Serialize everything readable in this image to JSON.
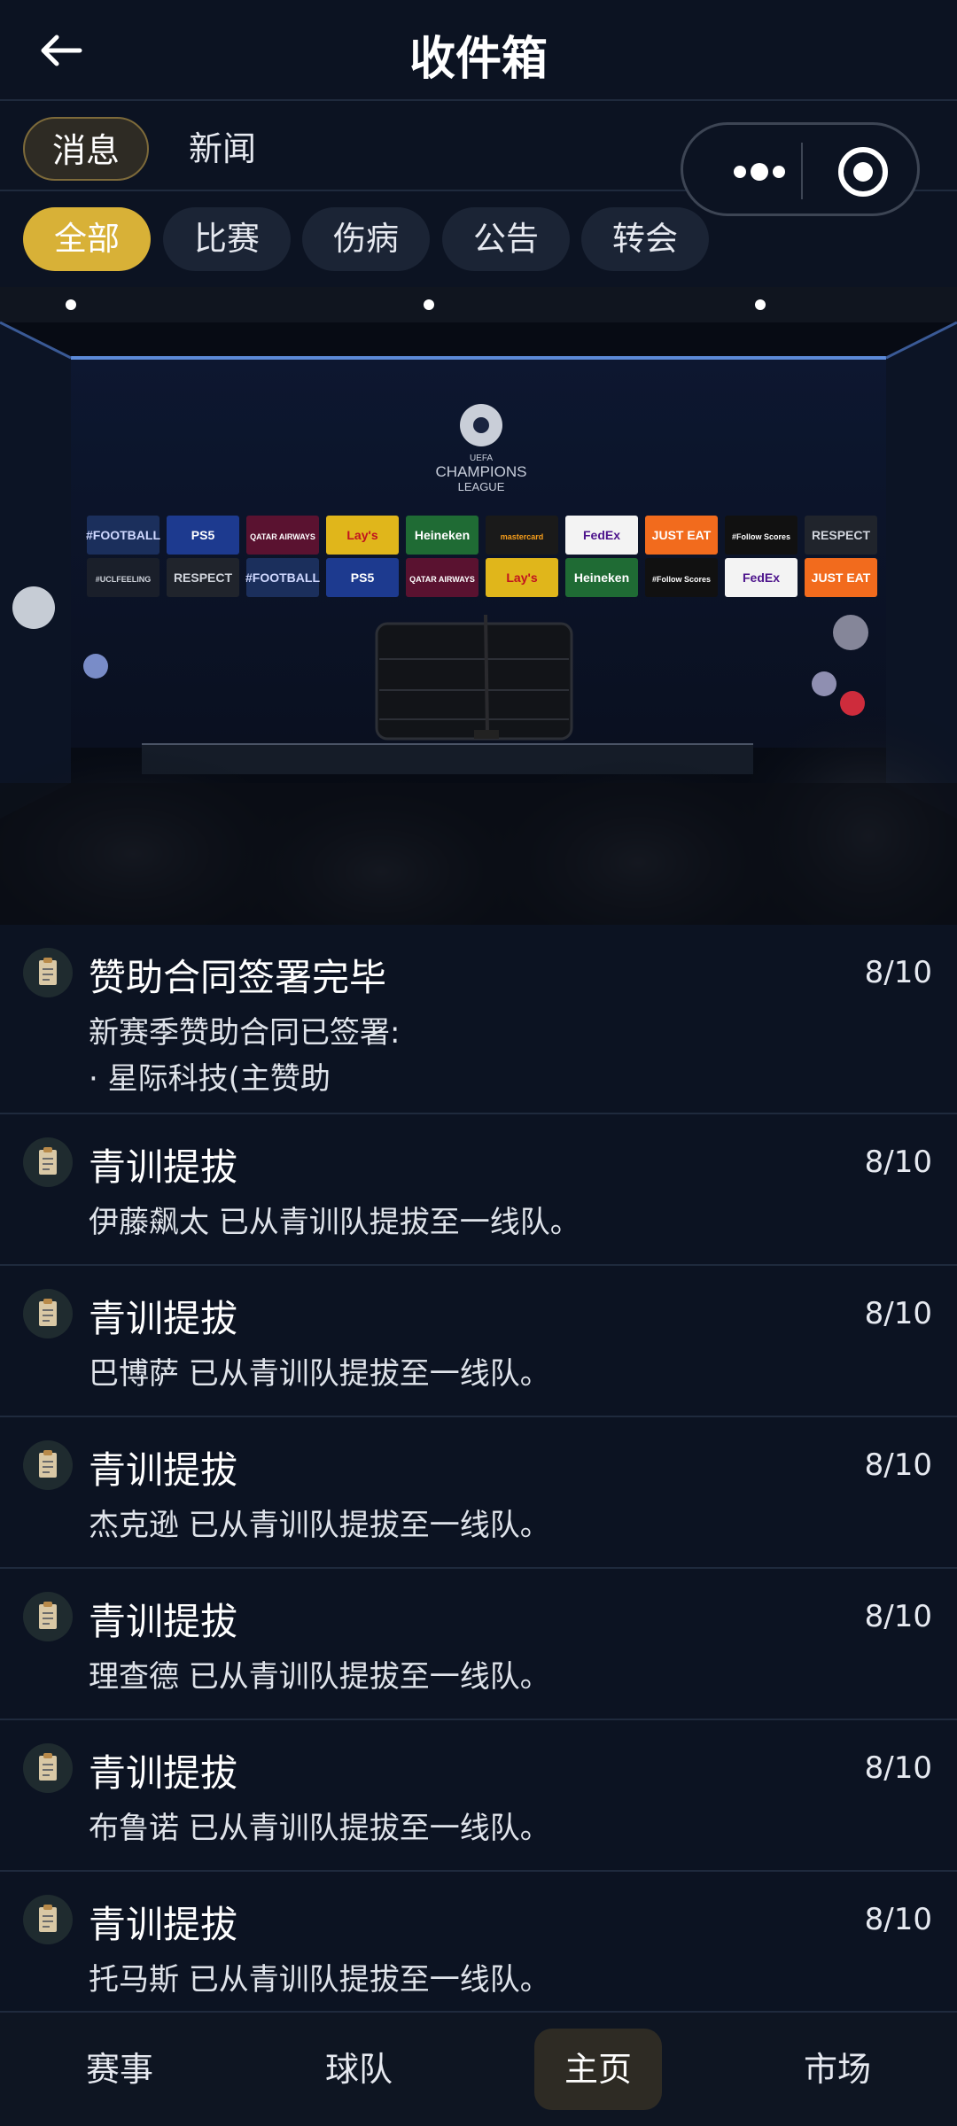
{
  "header": {
    "title": "收件箱",
    "back_icon": "arrow-left-icon"
  },
  "main_tabs": [
    {
      "label": "消息",
      "active": true
    },
    {
      "label": "新闻",
      "active": false
    }
  ],
  "capsule": {
    "more_icon": "more-dots-icon",
    "close_icon": "record-circle-icon"
  },
  "filters": [
    {
      "label": "全部",
      "active": true
    },
    {
      "label": "比赛",
      "active": false
    },
    {
      "label": "伤病",
      "active": false
    },
    {
      "label": "公告",
      "active": false
    },
    {
      "label": "转会",
      "active": false
    }
  ],
  "banner": {
    "logo_line1": "UEFA",
    "logo_line2": "CHAMPIONS",
    "logo_line3": "LEAGUE",
    "sponsors_row1": [
      "#FOOTBALL",
      "PS5",
      "QATAR AIRWAYS",
      "Lay's",
      "Heineken",
      "mastercard",
      "FedEx",
      "JUST EAT",
      "#Follow Scores",
      "RESPECT"
    ],
    "sponsors_row2": [
      "#UCLFEELING",
      "RESPECT",
      "#FOOTBALL",
      "PS5",
      "QATAR AIRWAYS",
      "Lay's",
      "Heineken",
      "#Follow Scores",
      "FedEx",
      "JUST EAT"
    ]
  },
  "messages": [
    {
      "title": "赞助合同签署完毕",
      "date": "8/10",
      "body": "新赛季赞助合同已签署:\n· 星际科技(主赞助",
      "icon": "clipboard-icon"
    },
    {
      "title": "青训提拔",
      "date": "8/10",
      "body": "伊藤飙太 已从青训队提拔至一线队。",
      "icon": "clipboard-icon"
    },
    {
      "title": "青训提拔",
      "date": "8/10",
      "body": "巴博萨 已从青训队提拔至一线队。",
      "icon": "clipboard-icon"
    },
    {
      "title": "青训提拔",
      "date": "8/10",
      "body": "杰克逊 已从青训队提拔至一线队。",
      "icon": "clipboard-icon"
    },
    {
      "title": "青训提拔",
      "date": "8/10",
      "body": "理查德 已从青训队提拔至一线队。",
      "icon": "clipboard-icon"
    },
    {
      "title": "青训提拔",
      "date": "8/10",
      "body": "布鲁诺 已从青训队提拔至一线队。",
      "icon": "clipboard-icon"
    },
    {
      "title": "青训提拔",
      "date": "8/10",
      "body": "托马斯 已从青训队提拔至一线队。",
      "icon": "clipboard-icon"
    }
  ],
  "bottom_nav": [
    {
      "label": "赛事",
      "active": false
    },
    {
      "label": "球队",
      "active": false
    },
    {
      "label": "主页",
      "active": true
    },
    {
      "label": "市场",
      "active": false
    }
  ],
  "colors": {
    "background": "#0c1322",
    "accent": "#d8b137",
    "chip": "#1b2435",
    "active_tab": "#2e2b24"
  }
}
